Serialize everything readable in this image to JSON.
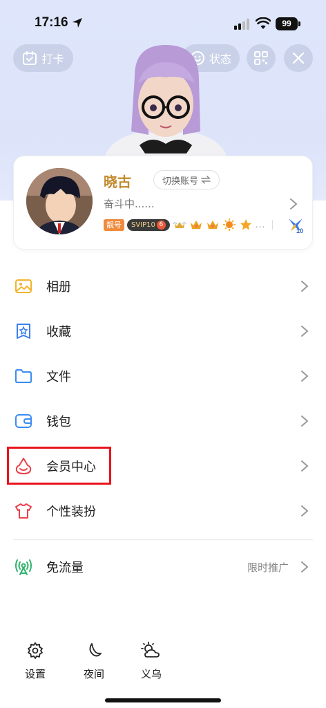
{
  "status_bar": {
    "time": "17:16",
    "battery": "99"
  },
  "header": {
    "checkin_label": "打卡",
    "status_label": "状态"
  },
  "profile": {
    "nickname": "晓古",
    "switch_account_label": "切换账号",
    "signature": "奋斗中......",
    "badge_liang": "靓号",
    "badge_svip": "SVIP10",
    "badge_svip_level": "6",
    "badge_more": "...",
    "level": "10"
  },
  "menu": {
    "items": [
      {
        "label": "相册",
        "icon": "album-icon"
      },
      {
        "label": "收藏",
        "icon": "favorites-icon"
      },
      {
        "label": "文件",
        "icon": "folder-icon"
      },
      {
        "label": "钱包",
        "icon": "wallet-icon"
      },
      {
        "label": "会员中心",
        "icon": "vip-icon"
      },
      {
        "label": "个性装扮",
        "icon": "outfit-icon"
      },
      {
        "label": "免流量",
        "icon": "free-data-icon",
        "extra": "限时推广"
      }
    ]
  },
  "bottom_bar": {
    "settings_label": "设置",
    "night_label": "夜间",
    "weather_label": "义乌"
  },
  "colors": {
    "highlight": "#e8141c",
    "nickname": "#c28a2c",
    "hero_bg": "#dfe6fb"
  }
}
